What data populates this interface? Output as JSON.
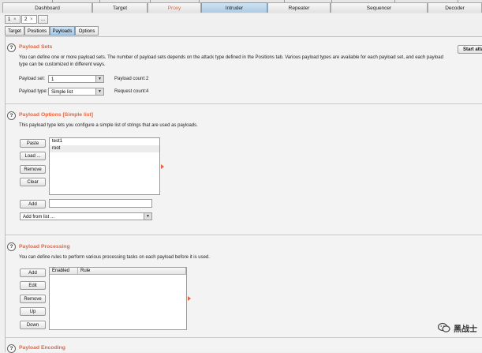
{
  "main_tabs": [
    {
      "label": "Dashboard"
    },
    {
      "label": "Target"
    },
    {
      "label": "Proxy"
    },
    {
      "label": "Intruder"
    },
    {
      "label": "Repeater"
    },
    {
      "label": "Sequencer"
    },
    {
      "label": "Decoder"
    }
  ],
  "attack_tabs": [
    {
      "label": "1",
      "close": "×"
    },
    {
      "label": "2",
      "close": "×"
    },
    {
      "label": "..."
    }
  ],
  "sub_tabs": [
    {
      "label": "Target"
    },
    {
      "label": "Positions"
    },
    {
      "label": "Payloads"
    },
    {
      "label": "Options"
    }
  ],
  "start_attack_label": "Start atta",
  "payload_sets": {
    "title": "Payload Sets",
    "description": "You can define one or more payload sets. The number of payload sets depends on the attack type defined in the Positions tab. Various payload types are available for each payload set, and each payload type can be customized in different ways.",
    "set_label": "Payload set:",
    "set_value": "1",
    "count_label": "Payload count:",
    "count_value": "2",
    "type_label": "Payload type:",
    "type_value": "Simple list",
    "request_label": "Request count:",
    "request_value": "4"
  },
  "payload_options": {
    "title": "Payload Options [Simple list]",
    "description": "This payload type lets you configure a simple list of strings that are used as payloads.",
    "buttons": [
      "Paste",
      "Load ...",
      "Remove",
      "Clear"
    ],
    "items": [
      "test1",
      "root"
    ],
    "add_label": "Add",
    "add_from_list": "Add from list ..."
  },
  "payload_processing": {
    "title": "Payload Processing",
    "description": "You can define rules to perform various processing tasks on each payload before it is used.",
    "buttons": [
      "Add",
      "Edit",
      "Remove",
      "Up",
      "Down"
    ],
    "columns": [
      "Enabled",
      "Rule"
    ]
  },
  "payload_encoding": {
    "title": "Payload Encoding"
  },
  "watermark": {
    "text": "黑战士"
  },
  "icons": {
    "help": "help-icon",
    "dropdown": "dropdown-arrow-icon",
    "expand": "expand-arrow-icon",
    "wechat": "wechat-logo-icon"
  },
  "colors": {
    "accent": "#e8643c",
    "active_tab": "#aacbe5"
  }
}
